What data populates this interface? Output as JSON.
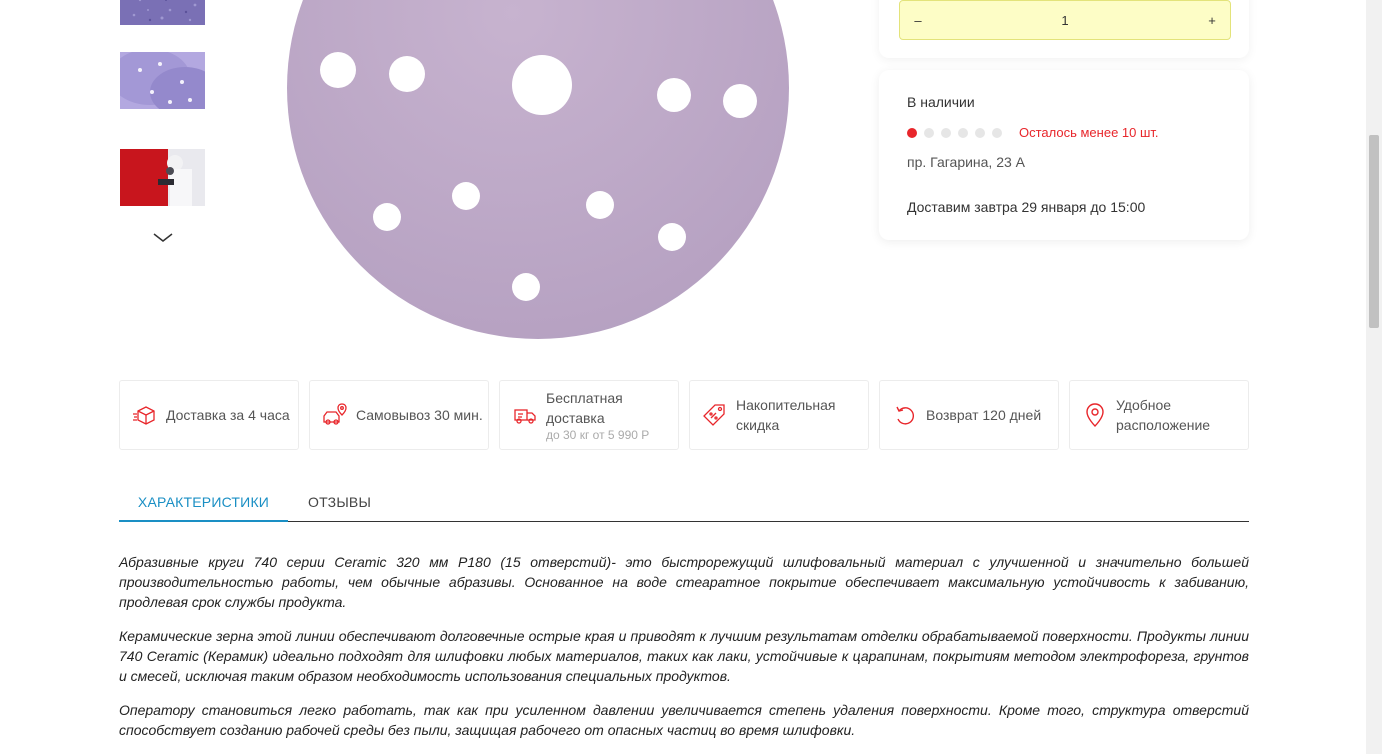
{
  "quantity": {
    "minus_label": "–",
    "value": "1",
    "plus_label": "+"
  },
  "stock": {
    "title": "В наличии",
    "level_filled": 1,
    "level_total": 6,
    "left_text": "Осталось менее 10 шт.",
    "address": "пр. Гагарина, 23 А",
    "delivery": "Доставим завтра 29 января до 15:00"
  },
  "features": [
    {
      "icon": "box-icon",
      "title": "Доставка за 4 часа"
    },
    {
      "icon": "truck-pin-icon",
      "title": "Самовывоз 30 мин."
    },
    {
      "icon": "delivery-truck-icon",
      "title": "Бесплатная доставка",
      "subtitle": "до 30 кг от 5 990 Р"
    },
    {
      "icon": "discount-tag-icon",
      "title": "Накопительная скидка"
    },
    {
      "icon": "return-icon",
      "title": "Возврат 120 дней"
    },
    {
      "icon": "location-pin-icon",
      "title": "Удобное расположение"
    }
  ],
  "tabs": [
    {
      "label": "ХАРАКТЕРИСТИКИ",
      "active": true
    },
    {
      "label": "ОТЗЫВЫ",
      "active": false
    }
  ],
  "description": [
    "Абразивные круги 740 серии Ceramic 320 мм P180 (15 отверстий)- это быстрорежущий шлифовальный материал с улучшенной и значительно большей производительностью работы, чем обычные абразивы. Основанное на воде стеаратное покрытие обеспечивает максимальную устойчивость к забиванию, продлевая срок службы продукта.",
    "Керамические зерна этой линии обеспечивают долговечные острые края и приводят к лучшим результатам отделки обрабатываемой поверхности. Продукты линии 740 Ceramic (Керамик) идеально подходят для шлифовки любых материалов, таких как лаки, устойчивые к царапинам, покрытиям методом электрофореза, грунтов и смесей, исключая таким образом необходимость использования специальных продуктов.",
    "Оператору становиться легко работать, так как при усиленном давлении увеличивается степень удаления поверхности. Кроме того, структура отверстий способствует созданию рабочей среды без пыли, защищая рабочего от опасных частиц во время шлифовки."
  ],
  "colors": {
    "accent": "#1a8fc4",
    "stock_red": "#e8262b",
    "qty_bg": "#fdfdc6",
    "disc": "#c3aac8"
  }
}
